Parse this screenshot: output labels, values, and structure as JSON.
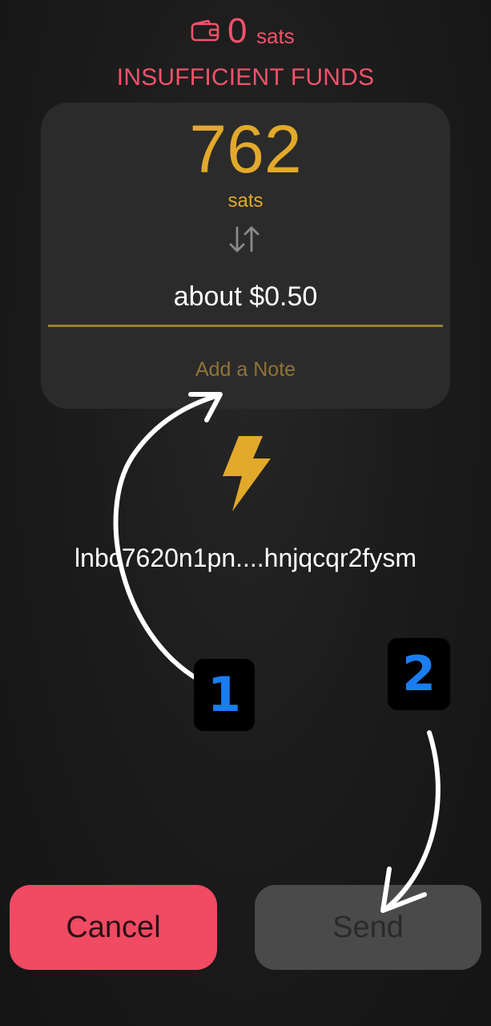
{
  "balance": {
    "icon": "wallet-icon",
    "amount": "0",
    "unit": "sats",
    "color": "#f2526a"
  },
  "warning": "INSUFFICIENT FUNDS",
  "amount_card": {
    "value": "762",
    "unit": "sats",
    "swap_icon": "swap-vertical-icon",
    "fiat": "about $0.50",
    "note_placeholder": "Add a Note",
    "accent": "#e2a92b"
  },
  "lightning_icon": "lightning-bolt-icon",
  "invoice": "lnbc7620n1pn....hnjqcqr2fysm",
  "buttons": {
    "cancel": "Cancel",
    "send": "Send"
  },
  "annotations": {
    "step1": "1",
    "step2": "2"
  }
}
